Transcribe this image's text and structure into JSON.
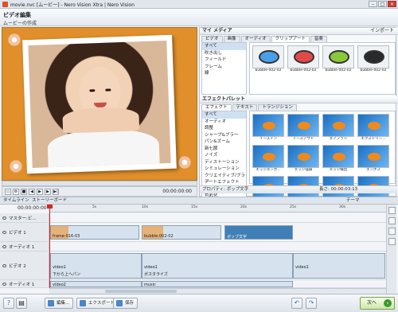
{
  "window": {
    "title": "movie.nvc [ムービー] - Nero Vision Xtra | Nero Vision"
  },
  "header": {
    "title": "ビデオ編集",
    "subtitle": "ムービーの作成"
  },
  "preview": {
    "time": "00:00:00:00"
  },
  "media": {
    "section_title": "マイ メディア",
    "import_label": "インポート",
    "tabs": [
      "ビデオ",
      "画像",
      "オーディオ",
      "クリップアート",
      "音楽"
    ],
    "active_tab": 3,
    "categories": [
      "すべて",
      "吹き出し",
      "フィールド",
      "フレーム",
      "線"
    ],
    "items": [
      {
        "caption": "bubble-002-02",
        "color": "#4aa0e8"
      },
      {
        "caption": "bubble-002-02",
        "color": "#e04a4a"
      },
      {
        "caption": "bubble-002-02",
        "color": "#8ac83a"
      },
      {
        "caption": "bubble-002-02",
        "color": "#2a2a2a"
      }
    ]
  },
  "effects": {
    "section_title": "エフェクトパレット",
    "tabs": [
      "エフェクト",
      "テキスト",
      "トランジション"
    ],
    "active_tab": 0,
    "categories": [
      "すべて",
      "オーディオ",
      "調整",
      "シャープ&ブラー",
      "パン&ズーム",
      "新七節",
      "ノイズ",
      "ディストーション",
      "シミュレーション",
      "クリエイティブ/ブラー",
      "アートエフェクト",
      "カメラ",
      "色彩化"
    ],
    "items": [
      "イーズイン",
      "イーズアウト",
      "エアブラシ",
      "エクストリー...",
      "エッジエンボ...",
      "エッジ強調",
      "エッジ検出",
      "エンボス",
      "",
      "",
      "",
      ""
    ]
  },
  "properties": {
    "label": "プロパティ: ポップ文字",
    "duration": "長さ: 00:00:03:13"
  },
  "timeline": {
    "tab_timeline": "タイムライン",
    "tab_storyboard": "ストーリーボード",
    "theme_label": "テーマ",
    "timecode": "00:00:00:00",
    "ruler": [
      "00:00:00:00",
      "5s",
      "10s",
      "15s",
      "20s",
      "25s",
      "30s"
    ],
    "tracks": [
      {
        "name": "マスター:ビ..."
      },
      {
        "name": "ビデオ 1"
      },
      {
        "name": "オーディオ 1"
      },
      {
        "name": "ビデオ 2"
      },
      {
        "name": "オーディオ 1"
      }
    ],
    "clips": {
      "frame": "frame-016-03",
      "bubble": "bubble-002-02",
      "pop": "ポップ文字",
      "video1a": "video1",
      "video1b": "video1",
      "video1c": "video1",
      "video2a": "video2",
      "video2b": "video2",
      "pan": "下から上へパン",
      "posterize": "ポスタライズ",
      "music": "music"
    }
  },
  "bottom": {
    "edit_label": "編集...",
    "export_label": "エクスポート",
    "save_label": "保存",
    "next_label": "次へ"
  }
}
